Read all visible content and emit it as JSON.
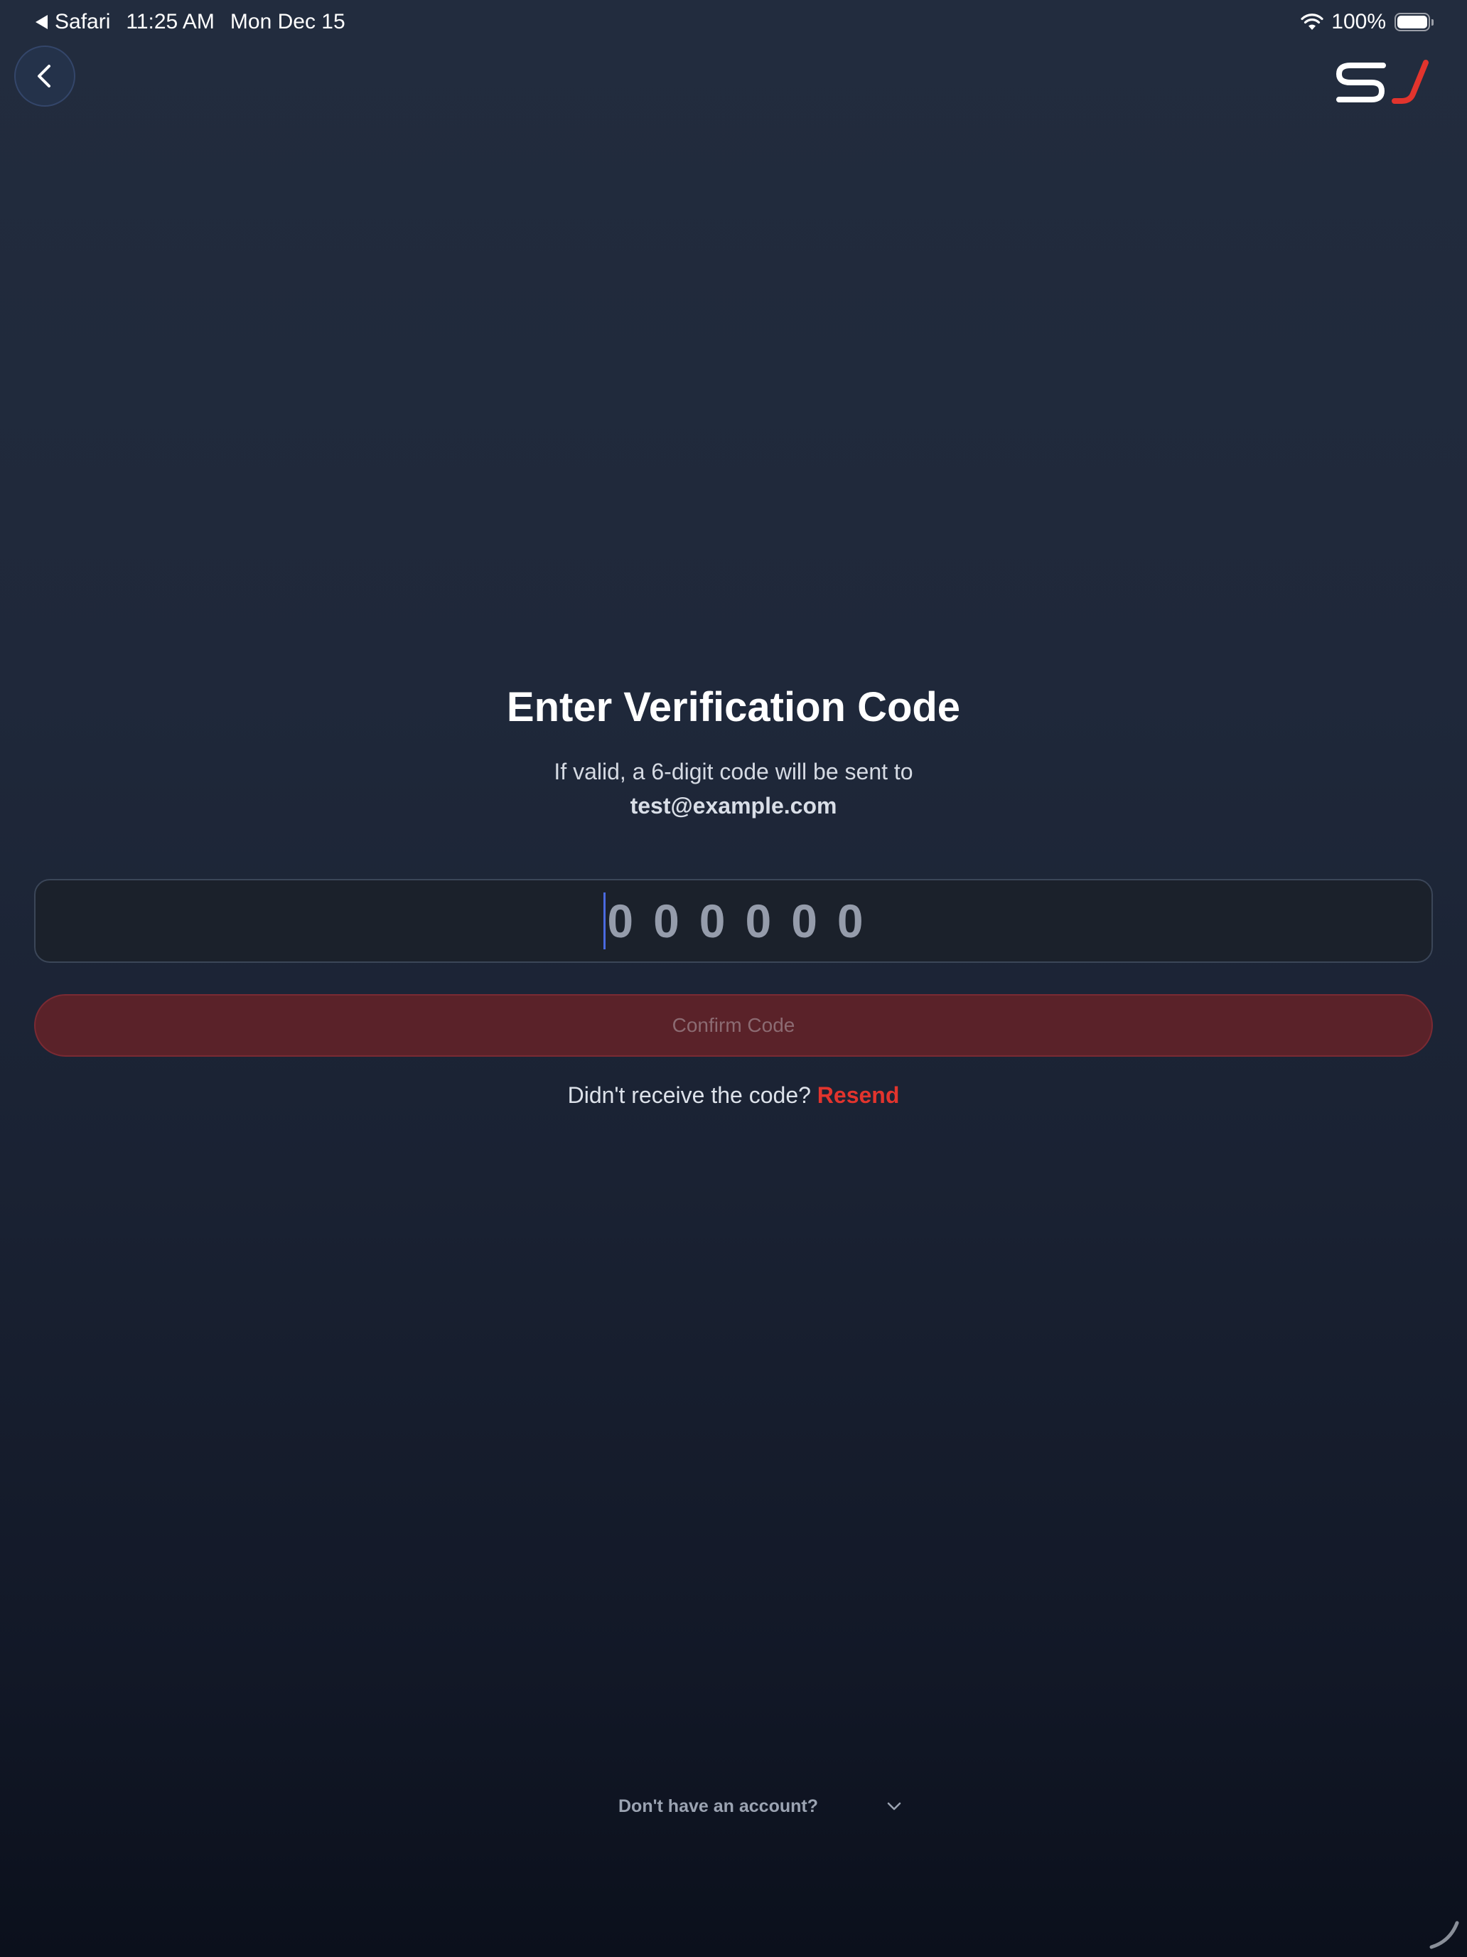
{
  "status_bar": {
    "app": "Safari",
    "time": "11:25 AM",
    "date": "Mon Dec 15",
    "battery": "100%"
  },
  "header": {
    "back_icon": "chevron-left-icon",
    "logo": {
      "text": "SJ",
      "colors": {
        "s": "#ffffff",
        "j": "#e2342d"
      }
    }
  },
  "main": {
    "title": "Enter Verification Code",
    "subtitle": "If valid, a 6-digit code will be sent to",
    "email": "test@example.com",
    "code_input": {
      "placeholder": "000000",
      "value": ""
    },
    "confirm_label": "Confirm Code",
    "resend_prompt": "Didn't receive the code?",
    "resend_label": "Resend"
  },
  "footer": {
    "account_prompt": "Don't have an account?",
    "chevron_icon": "chevron-down-icon"
  },
  "colors": {
    "accent": "#e2342d",
    "button_bg": "#5a2229",
    "background_top": "#222c3e",
    "background_bottom": "#0b101c",
    "input_bg": "#1b212b"
  }
}
